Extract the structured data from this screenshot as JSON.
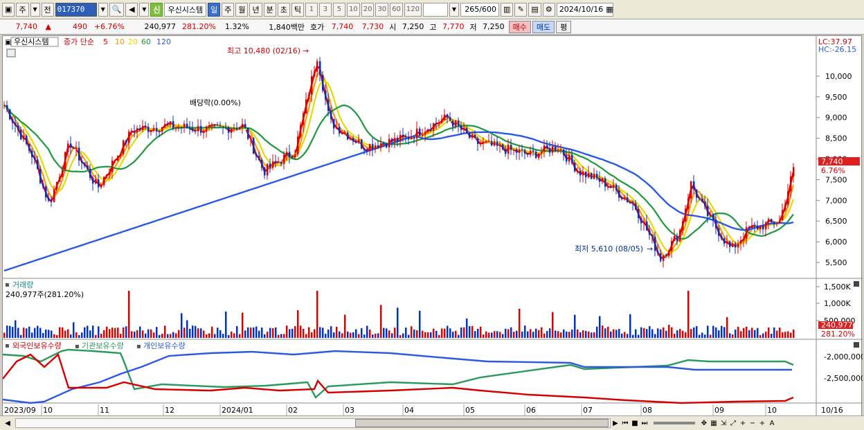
{
  "toolbar": {
    "market_label": "주",
    "prev_label": "전",
    "stock_code": "017370",
    "stock_name": "우신시스템",
    "new_badge": "신",
    "periods": [
      "일",
      "주",
      "월",
      "년",
      "분",
      "초",
      "틱"
    ],
    "active_period": "일",
    "intervals": [
      "1",
      "3",
      "5",
      "10",
      "20",
      "30",
      "60",
      "120"
    ],
    "count_value": "265",
    "count_total": "600",
    "date_value": "2024/10/16"
  },
  "quote": {
    "price": "7,740",
    "change_arrow": "▲",
    "change": "490",
    "change_pct": "+6.76%",
    "volume": "240,977",
    "volume_ratio": "281.20%",
    "turnover": "1.32%",
    "amount": "1,840백만",
    "bid_label": "호가",
    "ask_price": "7,740",
    "bid_price": "7,730",
    "open_label": "시",
    "open": "7,250",
    "high_label": "고",
    "high": "7,770",
    "low_label": "저",
    "low": "7,250",
    "buy_label": "매수",
    "sell_label": "매도",
    "eval_label": "평"
  },
  "price_panel": {
    "stock_name": "우신시스템",
    "ma_label": "종가 단순",
    "ma_periods": [
      "5",
      "10",
      "20",
      "60",
      "120"
    ],
    "ma_colors": [
      "#e00000",
      "#ff9900",
      "#e8d800",
      "#1a9a3a",
      "#2a5ae0"
    ],
    "lc_label": "LC:37.97",
    "hc_label": "HC:-26.15",
    "max_label": "최고 10,480 (02/16)",
    "min_label": "최저 5,610 (08/05)",
    "dividend_label": "배당락(0.00%)",
    "current_price_tag": "7,740",
    "current_pct_tag": "6.76%",
    "y_ticks": [
      "10,000",
      "9,500",
      "9,000",
      "8,500",
      "8,000",
      "7,500",
      "7,000",
      "6,500",
      "6,000",
      "5,500"
    ]
  },
  "volume_panel": {
    "title": "거래량",
    "value_label": "240,977주(281.20%)",
    "y_ticks": [
      "1,500K",
      "1,000K",
      "500,000"
    ],
    "current_tag": "240,977",
    "current_pct_tag": "281.20%"
  },
  "holdings_panel": {
    "legend": [
      "외국인보유수량",
      "기관보유수량",
      "개인보유수량"
    ],
    "legend_colors": [
      "#d40000",
      "#2a9a5a",
      "#2a5ae0"
    ],
    "y_ticks": [
      "-2,000,000",
      "-2,500,000"
    ]
  },
  "x_axis": {
    "labels": [
      "2023/09",
      "10",
      "11",
      "12",
      "2024/01",
      "02",
      "03",
      "04",
      "05",
      "06",
      "07",
      "08",
      "09",
      "10",
      "10/16"
    ]
  },
  "chart_data": {
    "type": "line",
    "title": "",
    "series": [
      {
        "name": "종가",
        "x": [
          "2023/09",
          "2023/10",
          "2023/11",
          "2023/12",
          "2024/01",
          "2024/02",
          "2024/02/16",
          "2024/03",
          "2024/04",
          "2024/05",
          "2024/06",
          "2024/07",
          "2024/08/05",
          "2024/09",
          "2024/10",
          "2024/10/16"
        ],
        "values": [
          9300,
          7200,
          8000,
          8700,
          8800,
          8100,
          10480,
          8300,
          8600,
          8600,
          8200,
          7900,
          5610,
          6000,
          6500,
          7740
        ]
      }
    ],
    "ylim": [
      5200,
      10500
    ]
  }
}
